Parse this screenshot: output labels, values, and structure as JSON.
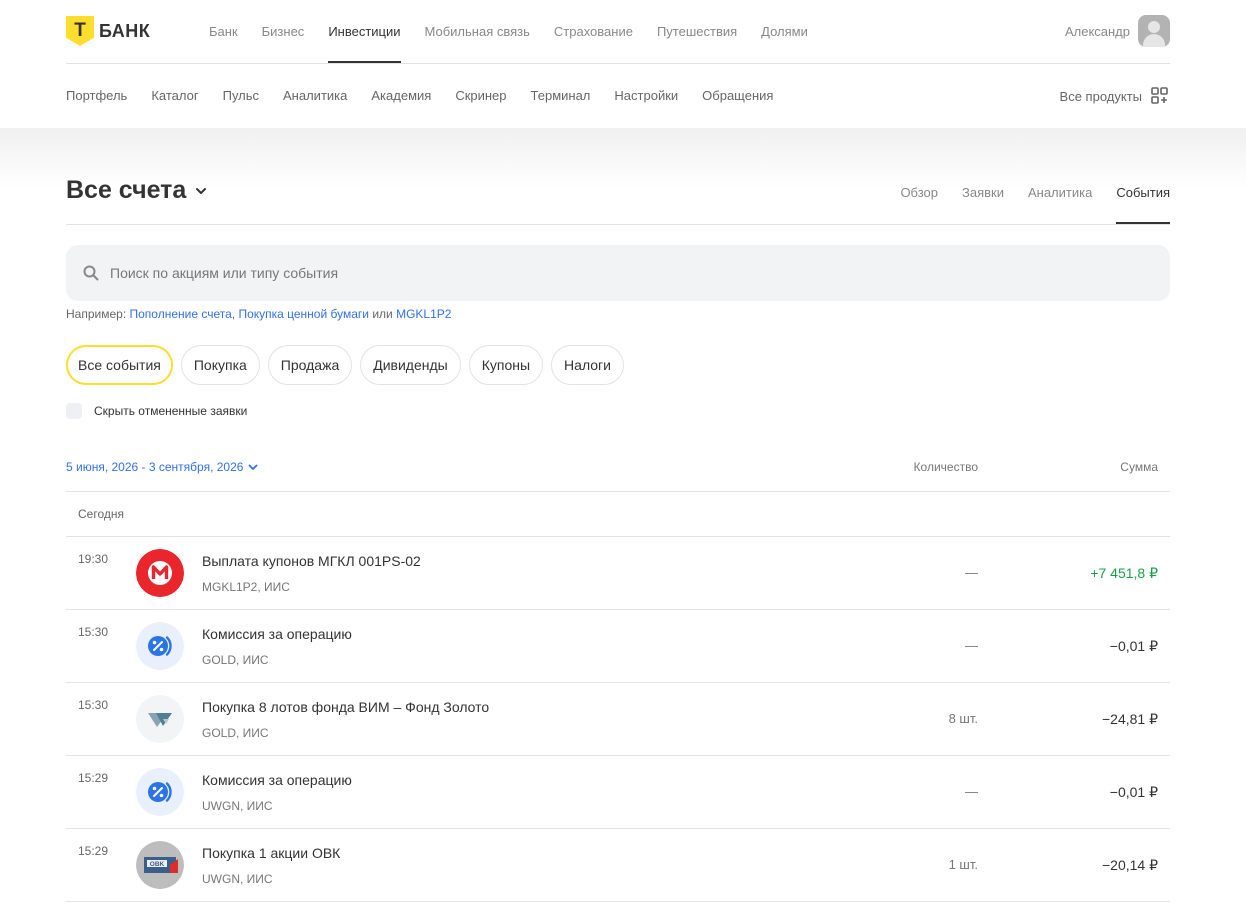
{
  "brand": {
    "mark": "Т",
    "name": "БАНК",
    "accent": "#ffdd2d"
  },
  "topnav": [
    {
      "label": "Банк",
      "active": false
    },
    {
      "label": "Бизнес",
      "active": false
    },
    {
      "label": "Инвестиции",
      "active": true
    },
    {
      "label": "Мобильная связь",
      "active": false
    },
    {
      "label": "Страхование",
      "active": false
    },
    {
      "label": "Путешествия",
      "active": false
    },
    {
      "label": "Долями",
      "active": false
    }
  ],
  "user": {
    "name": "Александр"
  },
  "subnav": [
    "Портфель",
    "Каталог",
    "Пульс",
    "Аналитика",
    "Академия",
    "Скринер",
    "Терминал",
    "Настройки",
    "Обращения"
  ],
  "all_products": {
    "label": "Все продукты"
  },
  "page": {
    "title": "Все счета"
  },
  "tabs": [
    {
      "label": "Обзор",
      "active": false
    },
    {
      "label": "Заявки",
      "active": false
    },
    {
      "label": "Аналитика",
      "active": false
    },
    {
      "label": "События",
      "active": true
    }
  ],
  "search": {
    "placeholder": "Поиск по акциям или типу события",
    "value": ""
  },
  "example": {
    "prefix": "Например: ",
    "link1": "Пополнение счета",
    "sep": ", ",
    "link2": "Покупка ценной бумаги",
    "or": " или ",
    "link3": "MGKL1P2"
  },
  "filters": [
    {
      "label": "Все события",
      "active": true
    },
    {
      "label": "Покупка",
      "active": false
    },
    {
      "label": "Продажа",
      "active": false
    },
    {
      "label": "Дивиденды",
      "active": false
    },
    {
      "label": "Купоны",
      "active": false
    },
    {
      "label": "Налоги",
      "active": false
    }
  ],
  "hide_cancelled": {
    "label": "Скрыть отмененные заявки",
    "checked": false
  },
  "list_header": {
    "range": "5 июня, 2026 - 3 сентября, 2026",
    "qty": "Количество",
    "sum": "Сумма"
  },
  "group": {
    "label": "Сегодня"
  },
  "events": [
    {
      "time": "19:30",
      "icon": "mgkl-logo-icon",
      "title": "Выплата купонов МГКЛ 001PS-02",
      "sub": "MGKL1P2, ИИС",
      "qty": "—",
      "sum": "+7 451,8 ₽",
      "positive": true
    },
    {
      "time": "15:30",
      "icon": "commission-percent-icon",
      "title": "Комиссия за операцию",
      "sub": "GOLD, ИИС",
      "qty": "—",
      "sum": "−0,01 ₽",
      "positive": false
    },
    {
      "time": "15:30",
      "icon": "vim-fund-logo-icon",
      "title": "Покупка 8 лотов фонда ВИМ – Фонд Золото",
      "sub": "GOLD, ИИС",
      "qty": "8 шт.",
      "sum": "−24,81 ₽",
      "positive": false
    },
    {
      "time": "15:29",
      "icon": "commission-percent-icon",
      "title": "Комиссия за операцию",
      "sub": "UWGN, ИИС",
      "qty": "—",
      "sum": "−0,01 ₽",
      "positive": false
    },
    {
      "time": "15:29",
      "icon": "ovk-logo-icon",
      "title": "Покупка 1 акции ОВК",
      "sub": "UWGN, ИИС",
      "qty": "1 шт.",
      "sum": "−20,14 ₽",
      "positive": false
    }
  ]
}
